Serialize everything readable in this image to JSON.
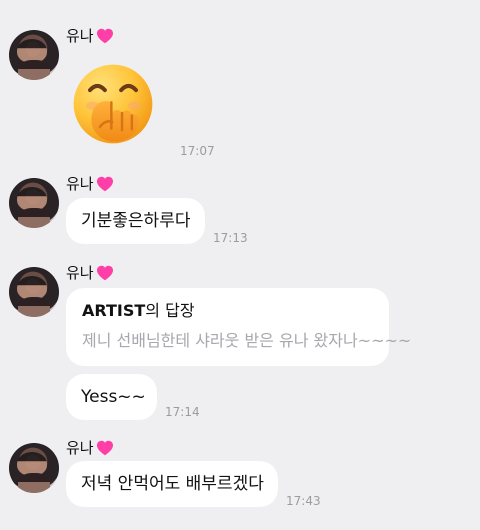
{
  "messages": [
    {
      "sender": "유나",
      "type": "emoji",
      "emoji_name": "face-with-hand-over-mouth",
      "time": "17:07"
    },
    {
      "sender": "유나",
      "type": "text",
      "text": "기분좋은하루다",
      "time": "17:13"
    },
    {
      "sender": "유나",
      "type": "reply",
      "reply": {
        "title_artist": "ARTIST",
        "title_suffix": "의 답장",
        "quoted_text": "제니 선배님한테 샤라웃 받은 유나 왔자나~~~~"
      },
      "text": "Yess~~",
      "time": "17:14"
    },
    {
      "sender": "유나",
      "type": "text",
      "text": "저녁 안먹어도 배부르겠다",
      "time": "17:43"
    }
  ],
  "colors": {
    "background": "#efeff1",
    "bubble": "#ffffff",
    "time": "#9b9ba2",
    "heart": "#ff3fa8",
    "muted_text": "#a7a7ad"
  },
  "icons": {
    "heart": "heart-icon",
    "avatar": "profile-avatar",
    "sticker": "emoji-face-icon"
  }
}
